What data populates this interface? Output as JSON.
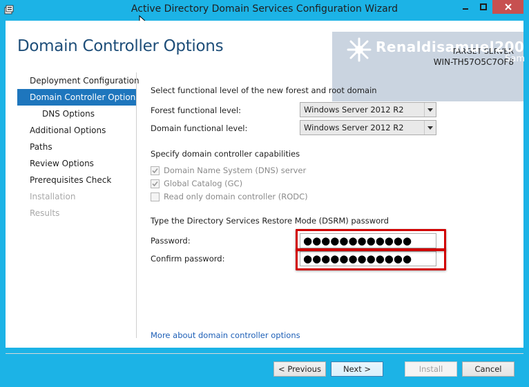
{
  "window": {
    "title": "Active Directory Domain Services Configuration Wizard"
  },
  "page": {
    "title": "Domain Controller Options"
  },
  "target": {
    "label": "TARGET SERVER",
    "name": "WIN-TH57O5C7OF8"
  },
  "watermark": {
    "name": "Renaldisamuel200",
    "sub": "Sam"
  },
  "nav": {
    "items": [
      {
        "label": "Deployment Configuration",
        "state": "normal"
      },
      {
        "label": "Domain Controller Options",
        "state": "active"
      },
      {
        "label": "DNS Options",
        "state": "sub"
      },
      {
        "label": "Additional Options",
        "state": "normal"
      },
      {
        "label": "Paths",
        "state": "normal"
      },
      {
        "label": "Review Options",
        "state": "normal"
      },
      {
        "label": "Prerequisites Check",
        "state": "normal"
      },
      {
        "label": "Installation",
        "state": "disabled"
      },
      {
        "label": "Results",
        "state": "disabled"
      }
    ]
  },
  "main": {
    "functional_heading": "Select functional level of the new forest and root domain",
    "forest_label": "Forest functional level:",
    "forest_value": "Windows Server 2012 R2",
    "domain_label": "Domain functional level:",
    "domain_value": "Windows Server 2012 R2",
    "capabilities_heading": "Specify domain controller capabilities",
    "capabilities": [
      {
        "label": "Domain Name System (DNS) server",
        "checked": true
      },
      {
        "label": "Global Catalog (GC)",
        "checked": true
      },
      {
        "label": "Read only domain controller (RODC)",
        "checked": false
      }
    ],
    "dsrm_heading": "Type the Directory Services Restore Mode (DSRM) password",
    "password_label": "Password:",
    "password_value": "●●●●●●●●●●●●",
    "confirm_label": "Confirm password:",
    "confirm_value": "●●●●●●●●●●●●",
    "more_link": "More about domain controller options"
  },
  "footer": {
    "previous": "< Previous",
    "next": "Next >",
    "install": "Install",
    "cancel": "Cancel"
  },
  "colors": {
    "accent": "#1cb3e6",
    "nav_active": "#1e76bd",
    "title": "#1e4e79",
    "highlight": "#d10000",
    "close": "#c75050"
  }
}
